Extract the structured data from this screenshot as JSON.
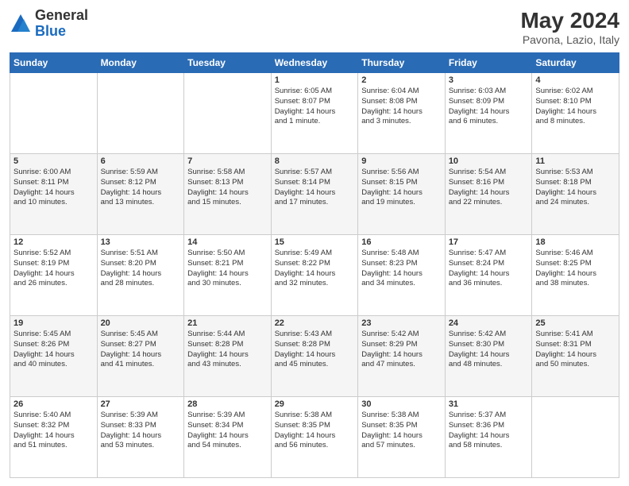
{
  "header": {
    "logo_general": "General",
    "logo_blue": "Blue",
    "title": "May 2024",
    "subtitle": "Pavona, Lazio, Italy"
  },
  "columns": [
    "Sunday",
    "Monday",
    "Tuesday",
    "Wednesday",
    "Thursday",
    "Friday",
    "Saturday"
  ],
  "weeks": [
    {
      "days": [
        {
          "num": "",
          "lines": []
        },
        {
          "num": "",
          "lines": []
        },
        {
          "num": "",
          "lines": []
        },
        {
          "num": "1",
          "lines": [
            "Sunrise: 6:05 AM",
            "Sunset: 8:07 PM",
            "Daylight: 14 hours",
            "and 1 minute."
          ]
        },
        {
          "num": "2",
          "lines": [
            "Sunrise: 6:04 AM",
            "Sunset: 8:08 PM",
            "Daylight: 14 hours",
            "and 3 minutes."
          ]
        },
        {
          "num": "3",
          "lines": [
            "Sunrise: 6:03 AM",
            "Sunset: 8:09 PM",
            "Daylight: 14 hours",
            "and 6 minutes."
          ]
        },
        {
          "num": "4",
          "lines": [
            "Sunrise: 6:02 AM",
            "Sunset: 8:10 PM",
            "Daylight: 14 hours",
            "and 8 minutes."
          ]
        }
      ]
    },
    {
      "days": [
        {
          "num": "5",
          "lines": [
            "Sunrise: 6:00 AM",
            "Sunset: 8:11 PM",
            "Daylight: 14 hours",
            "and 10 minutes."
          ]
        },
        {
          "num": "6",
          "lines": [
            "Sunrise: 5:59 AM",
            "Sunset: 8:12 PM",
            "Daylight: 14 hours",
            "and 13 minutes."
          ]
        },
        {
          "num": "7",
          "lines": [
            "Sunrise: 5:58 AM",
            "Sunset: 8:13 PM",
            "Daylight: 14 hours",
            "and 15 minutes."
          ]
        },
        {
          "num": "8",
          "lines": [
            "Sunrise: 5:57 AM",
            "Sunset: 8:14 PM",
            "Daylight: 14 hours",
            "and 17 minutes."
          ]
        },
        {
          "num": "9",
          "lines": [
            "Sunrise: 5:56 AM",
            "Sunset: 8:15 PM",
            "Daylight: 14 hours",
            "and 19 minutes."
          ]
        },
        {
          "num": "10",
          "lines": [
            "Sunrise: 5:54 AM",
            "Sunset: 8:16 PM",
            "Daylight: 14 hours",
            "and 22 minutes."
          ]
        },
        {
          "num": "11",
          "lines": [
            "Sunrise: 5:53 AM",
            "Sunset: 8:18 PM",
            "Daylight: 14 hours",
            "and 24 minutes."
          ]
        }
      ]
    },
    {
      "days": [
        {
          "num": "12",
          "lines": [
            "Sunrise: 5:52 AM",
            "Sunset: 8:19 PM",
            "Daylight: 14 hours",
            "and 26 minutes."
          ]
        },
        {
          "num": "13",
          "lines": [
            "Sunrise: 5:51 AM",
            "Sunset: 8:20 PM",
            "Daylight: 14 hours",
            "and 28 minutes."
          ]
        },
        {
          "num": "14",
          "lines": [
            "Sunrise: 5:50 AM",
            "Sunset: 8:21 PM",
            "Daylight: 14 hours",
            "and 30 minutes."
          ]
        },
        {
          "num": "15",
          "lines": [
            "Sunrise: 5:49 AM",
            "Sunset: 8:22 PM",
            "Daylight: 14 hours",
            "and 32 minutes."
          ]
        },
        {
          "num": "16",
          "lines": [
            "Sunrise: 5:48 AM",
            "Sunset: 8:23 PM",
            "Daylight: 14 hours",
            "and 34 minutes."
          ]
        },
        {
          "num": "17",
          "lines": [
            "Sunrise: 5:47 AM",
            "Sunset: 8:24 PM",
            "Daylight: 14 hours",
            "and 36 minutes."
          ]
        },
        {
          "num": "18",
          "lines": [
            "Sunrise: 5:46 AM",
            "Sunset: 8:25 PM",
            "Daylight: 14 hours",
            "and 38 minutes."
          ]
        }
      ]
    },
    {
      "days": [
        {
          "num": "19",
          "lines": [
            "Sunrise: 5:45 AM",
            "Sunset: 8:26 PM",
            "Daylight: 14 hours",
            "and 40 minutes."
          ]
        },
        {
          "num": "20",
          "lines": [
            "Sunrise: 5:45 AM",
            "Sunset: 8:27 PM",
            "Daylight: 14 hours",
            "and 41 minutes."
          ]
        },
        {
          "num": "21",
          "lines": [
            "Sunrise: 5:44 AM",
            "Sunset: 8:28 PM",
            "Daylight: 14 hours",
            "and 43 minutes."
          ]
        },
        {
          "num": "22",
          "lines": [
            "Sunrise: 5:43 AM",
            "Sunset: 8:28 PM",
            "Daylight: 14 hours",
            "and 45 minutes."
          ]
        },
        {
          "num": "23",
          "lines": [
            "Sunrise: 5:42 AM",
            "Sunset: 8:29 PM",
            "Daylight: 14 hours",
            "and 47 minutes."
          ]
        },
        {
          "num": "24",
          "lines": [
            "Sunrise: 5:42 AM",
            "Sunset: 8:30 PM",
            "Daylight: 14 hours",
            "and 48 minutes."
          ]
        },
        {
          "num": "25",
          "lines": [
            "Sunrise: 5:41 AM",
            "Sunset: 8:31 PM",
            "Daylight: 14 hours",
            "and 50 minutes."
          ]
        }
      ]
    },
    {
      "days": [
        {
          "num": "26",
          "lines": [
            "Sunrise: 5:40 AM",
            "Sunset: 8:32 PM",
            "Daylight: 14 hours",
            "and 51 minutes."
          ]
        },
        {
          "num": "27",
          "lines": [
            "Sunrise: 5:39 AM",
            "Sunset: 8:33 PM",
            "Daylight: 14 hours",
            "and 53 minutes."
          ]
        },
        {
          "num": "28",
          "lines": [
            "Sunrise: 5:39 AM",
            "Sunset: 8:34 PM",
            "Daylight: 14 hours",
            "and 54 minutes."
          ]
        },
        {
          "num": "29",
          "lines": [
            "Sunrise: 5:38 AM",
            "Sunset: 8:35 PM",
            "Daylight: 14 hours",
            "and 56 minutes."
          ]
        },
        {
          "num": "30",
          "lines": [
            "Sunrise: 5:38 AM",
            "Sunset: 8:35 PM",
            "Daylight: 14 hours",
            "and 57 minutes."
          ]
        },
        {
          "num": "31",
          "lines": [
            "Sunrise: 5:37 AM",
            "Sunset: 8:36 PM",
            "Daylight: 14 hours",
            "and 58 minutes."
          ]
        },
        {
          "num": "",
          "lines": []
        }
      ]
    }
  ]
}
